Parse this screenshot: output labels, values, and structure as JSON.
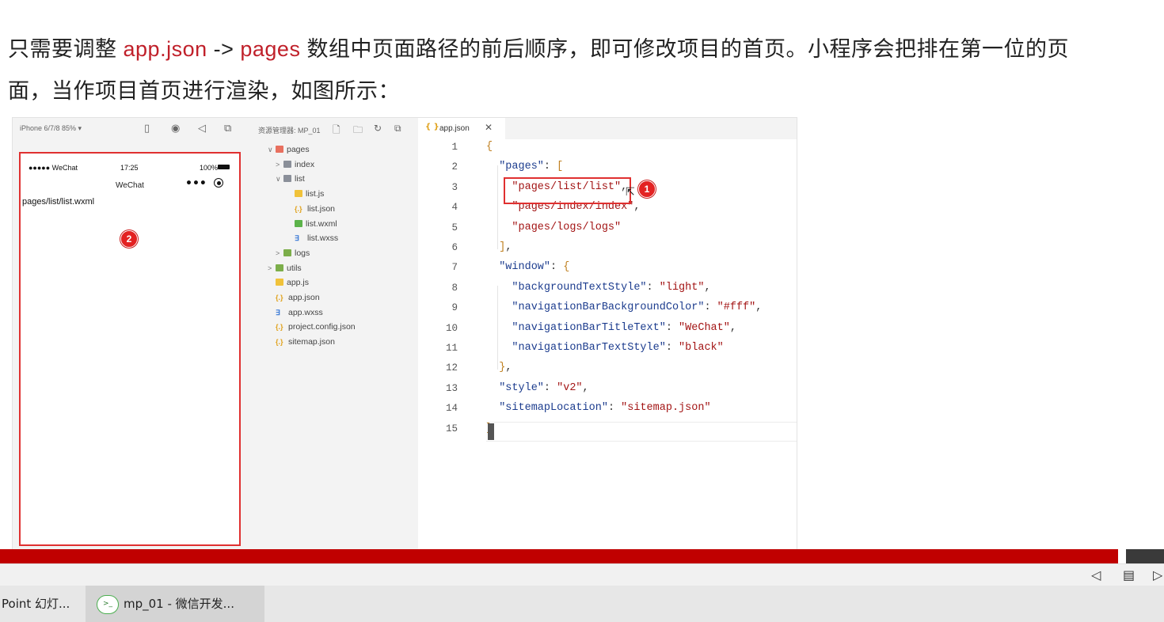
{
  "slide": {
    "line1_pre": "只需要调整 ",
    "line1_kw1": "app.json",
    "line1_arrow": " -> ",
    "line1_kw2": "pages",
    "line1_post": " 数组中页面路径的前后顺序，即可修改项目的首页。小程序会把排在第一位的页",
    "line2": "面，当作项目首页进行渲染，如图所示："
  },
  "simulator": {
    "device_label": "iPhone 6/7/8 85% ▾",
    "toolbar_icons": [
      "phone-icon",
      "record-icon",
      "volume-icon",
      "copy-window-icon"
    ],
    "status_signal": "●●●●● WeChat",
    "status_time": "17:25",
    "status_battery": "100%",
    "nav_title": "WeChat",
    "capsule_dots": "•••",
    "page_text": "pages/list/list.wxml",
    "badge": "2"
  },
  "explorer": {
    "title": "资源管理器: MP_01",
    "tree": [
      {
        "label": "pages",
        "depth": 0,
        "arrow": "∨",
        "icon": "folder-red"
      },
      {
        "label": "index",
        "depth": 1,
        "arrow": ">",
        "icon": "folder-gray"
      },
      {
        "label": "list",
        "depth": 1,
        "arrow": "∨",
        "icon": "folder-gray"
      },
      {
        "label": "list.js",
        "depth": 2,
        "arrow": "",
        "icon": "js"
      },
      {
        "label": "list.json",
        "depth": 2,
        "arrow": "",
        "icon": "json"
      },
      {
        "label": "list.wxml",
        "depth": 2,
        "arrow": "",
        "icon": "wxml"
      },
      {
        "label": "list.wxss",
        "depth": 2,
        "arrow": "",
        "icon": "css"
      },
      {
        "label": "logs",
        "depth": 1,
        "arrow": ">",
        "icon": "folder-green"
      },
      {
        "label": "utils",
        "depth": 0,
        "arrow": ">",
        "icon": "folder-green"
      },
      {
        "label": "app.js",
        "depth": 0,
        "arrow": "",
        "icon": "js"
      },
      {
        "label": "app.json",
        "depth": 0,
        "arrow": "",
        "icon": "json"
      },
      {
        "label": "app.wxss",
        "depth": 0,
        "arrow": "",
        "icon": "css"
      },
      {
        "label": "project.config.json",
        "depth": 0,
        "arrow": "",
        "icon": "json"
      },
      {
        "label": "sitemap.json",
        "depth": 0,
        "arrow": "",
        "icon": "json"
      }
    ]
  },
  "editor": {
    "tab_icon": "{ }",
    "tab_label": "app.json",
    "tab_close": "✕",
    "badge": "1",
    "lines": [
      [
        [
          "brk",
          "{"
        ]
      ],
      [
        [
          "pn",
          "  "
        ],
        [
          "key",
          "\"pages\""
        ],
        [
          "pn",
          ": "
        ],
        [
          "brk",
          "["
        ]
      ],
      [
        [
          "pn",
          "    "
        ],
        [
          "str",
          "\"pages/list/list\""
        ],
        [
          "pn",
          ","
        ]
      ],
      [
        [
          "pn",
          "    "
        ],
        [
          "str",
          "\"pages/index/index\""
        ],
        [
          "pn",
          ","
        ]
      ],
      [
        [
          "pn",
          "    "
        ],
        [
          "str",
          "\"pages/logs/logs\""
        ]
      ],
      [
        [
          "pn",
          "  "
        ],
        [
          "brk",
          "]"
        ],
        [
          "pn",
          ","
        ]
      ],
      [
        [
          "pn",
          "  "
        ],
        [
          "key",
          "\"window\""
        ],
        [
          "pn",
          ": "
        ],
        [
          "brk",
          "{"
        ]
      ],
      [
        [
          "pn",
          "    "
        ],
        [
          "key",
          "\"backgroundTextStyle\""
        ],
        [
          "pn",
          ": "
        ],
        [
          "str",
          "\"light\""
        ],
        [
          "pn",
          ","
        ]
      ],
      [
        [
          "pn",
          "    "
        ],
        [
          "key",
          "\"navigationBarBackgroundColor\""
        ],
        [
          "pn",
          ": "
        ],
        [
          "str",
          "\"#fff\""
        ],
        [
          "pn",
          ","
        ]
      ],
      [
        [
          "pn",
          "    "
        ],
        [
          "key",
          "\"navigationBarTitleText\""
        ],
        [
          "pn",
          ": "
        ],
        [
          "str",
          "\"WeChat\""
        ],
        [
          "pn",
          ","
        ]
      ],
      [
        [
          "pn",
          "    "
        ],
        [
          "key",
          "\"navigationBarTextStyle\""
        ],
        [
          "pn",
          ": "
        ],
        [
          "str",
          "\"black\""
        ]
      ],
      [
        [
          "pn",
          "  "
        ],
        [
          "brk",
          "}"
        ],
        [
          "pn",
          ","
        ]
      ],
      [
        [
          "pn",
          "  "
        ],
        [
          "key",
          "\"style\""
        ],
        [
          "pn",
          ": "
        ],
        [
          "str",
          "\"v2\""
        ],
        [
          "pn",
          ","
        ]
      ],
      [
        [
          "pn",
          "  "
        ],
        [
          "key",
          "\"sitemapLocation\""
        ],
        [
          "pn",
          ": "
        ],
        [
          "str",
          "\"sitemap.json\""
        ]
      ],
      [
        [
          "brk",
          "}"
        ]
      ]
    ]
  },
  "colors": {
    "keyword_red": "#c0202a",
    "highlight_red": "#e03030",
    "progress_red": "#c00000"
  },
  "presentation": {
    "controls": [
      "prev-slide-icon",
      "reading-view-icon",
      "next-slide-icon"
    ]
  },
  "taskbar": {
    "items": [
      {
        "label": "Point 幻灯..."
      },
      {
        "label": "mp_01 - 微信开发..."
      }
    ]
  }
}
